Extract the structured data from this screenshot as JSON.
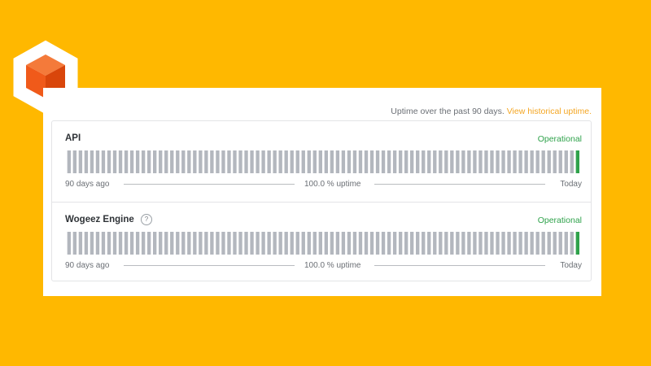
{
  "header": {
    "text": "Uptime over the past 90 days.",
    "link": "View historical uptime."
  },
  "components": [
    {
      "name": "API",
      "status": "Operational",
      "legend_left": "90 days ago",
      "legend_mid": "100.0 % uptime",
      "legend_right": "Today",
      "uptime_percent": 100.0,
      "has_help_icon": false
    },
    {
      "name": "Wogeez Engine",
      "status": "Operational",
      "legend_left": "90 days ago",
      "legend_mid": "100.0 % uptime",
      "legend_right": "Today",
      "uptime_percent": 100.0,
      "has_help_icon": true,
      "help_icon": "?"
    }
  ],
  "uptime_bars": {
    "day_count": 90,
    "no_data_color": "#b3b7be",
    "operational_color": "#2fa24b",
    "days_with_data": 1
  },
  "colors": {
    "background": "#FFB800",
    "link": "#F4A623",
    "status_operational": "#2fa24b",
    "logo_cube": "#F05A1A"
  },
  "icons": {
    "logo": "orange-cube-hexagon-logo",
    "help": "question-mark-circle-icon"
  }
}
